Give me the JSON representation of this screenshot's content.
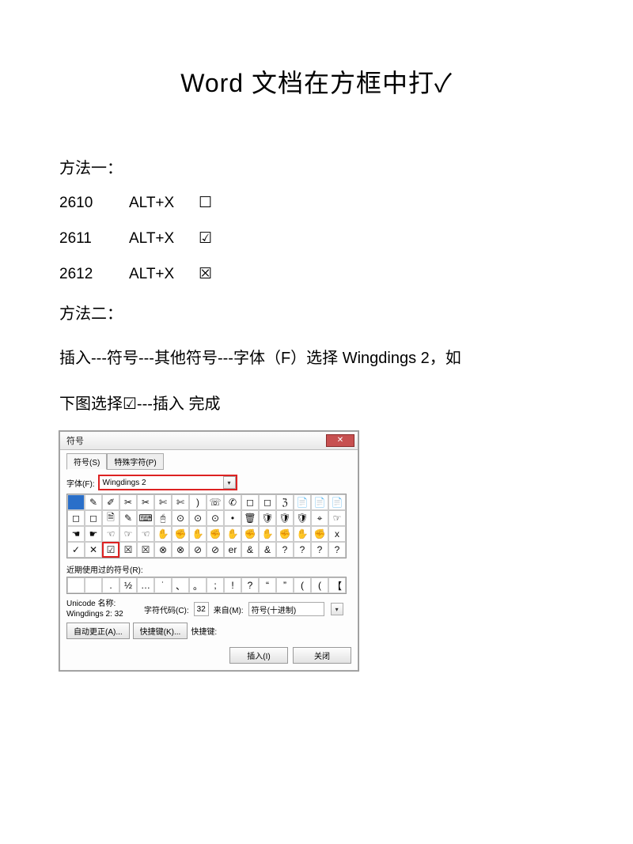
{
  "title": "Word 文档在方框中打✓",
  "method1": {
    "heading": "方法一：",
    "rows": [
      {
        "code": "2610",
        "combo": "ALT+X",
        "glyph": "☐"
      },
      {
        "code": "2611",
        "combo": "ALT+X",
        "glyph": "☑"
      },
      {
        "code": "2612",
        "combo": "ALT+X",
        "glyph": "☒"
      }
    ]
  },
  "method2": {
    "heading": "方法二：",
    "body_line1": "插入---符号---其他符号---字体（F）选择 Wingdings 2，如",
    "body_line2": "下图选择☑---插入 完成"
  },
  "dialog": {
    "caption": "符号",
    "close_glyph": "✕",
    "tab_symbols": "符号(S)",
    "tab_special": "特殊字符(P)",
    "font_label": "字体(F):",
    "font_value": "Wingdings 2",
    "dropdown_glyph": "▾",
    "grid": [
      [
        " ",
        "✎",
        "✐",
        "✂",
        "✂",
        "✄",
        "✄",
        ")",
        "☏",
        "✆",
        "◻",
        "◻",
        "ℨ",
        "📄",
        "📄",
        "📄"
      ],
      [
        "◻",
        "◻",
        "🗎",
        "✎",
        "⌨",
        "🖰",
        "⊙",
        "⊙",
        "⊙",
        "•",
        "🗑",
        "🛡",
        "🛡",
        "🛡",
        "⌖",
        "☞"
      ],
      [
        "☚",
        "☛",
        "☜",
        "☞",
        "☜",
        "✋",
        "✊",
        "✋",
        "✊",
        "✋",
        "✊",
        "✋",
        "✊",
        "✋",
        "✊",
        "x"
      ],
      [
        "✓",
        "✕",
        "☑",
        "☒",
        "☒",
        "⊗",
        "⊗",
        "⊘",
        "⊘",
        "er",
        "&",
        "&",
        "?",
        "?",
        "?",
        "?"
      ]
    ],
    "highlight": {
      "row": 3,
      "col": 2
    },
    "selected": {
      "row": 0,
      "col": 0
    },
    "recent_label": "近期使用过的符号(R):",
    "recent": [
      " ",
      " ",
      ".",
      "½",
      "…",
      "˙",
      "、",
      "。",
      ";",
      "!",
      "?",
      "“",
      "”",
      "(",
      "(",
      "【"
    ],
    "unicode_name_label": "Unicode 名称:",
    "unicode_name_value": "Wingdings 2: 32",
    "code_label": "字符代码(C):",
    "code_value": "32",
    "from_label": "来自(M):",
    "from_value": "符号(十进制)",
    "autocorrect_btn": "自动更正(A)...",
    "shortcut_btn": "快捷键(K)...",
    "shortcut_label": "快捷键:",
    "insert_btn": "插入(I)",
    "close_btn": "关闭"
  }
}
